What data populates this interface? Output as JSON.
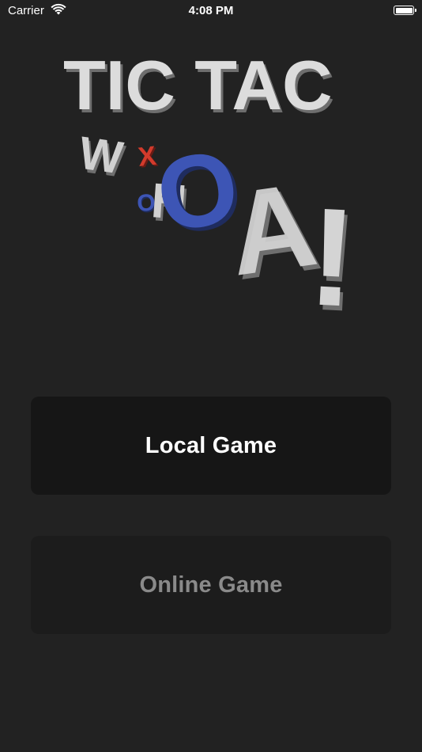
{
  "status_bar": {
    "carrier": "Carrier",
    "time": "4:08 PM",
    "wifi_icon": "wifi-icon",
    "battery_icon": "battery-icon",
    "battery_level": 1.0
  },
  "logo": {
    "line1": "TIC TAC",
    "letters": {
      "w": "W",
      "x": "X",
      "o_small": "O",
      "h": "H",
      "o_big": "O",
      "a": "A",
      "exclaim": "!"
    },
    "colors": {
      "text": "#d9d9d9",
      "x_mark": "#d23b2c",
      "o_mark": "#3d55b5"
    }
  },
  "buttons": {
    "local_game": "Local Game",
    "online_game": "Online Game"
  },
  "colors": {
    "background": "#222222",
    "button_bg": "#161616",
    "button_active_text": "#ffffff",
    "button_disabled_text": "#8a8a8a"
  }
}
